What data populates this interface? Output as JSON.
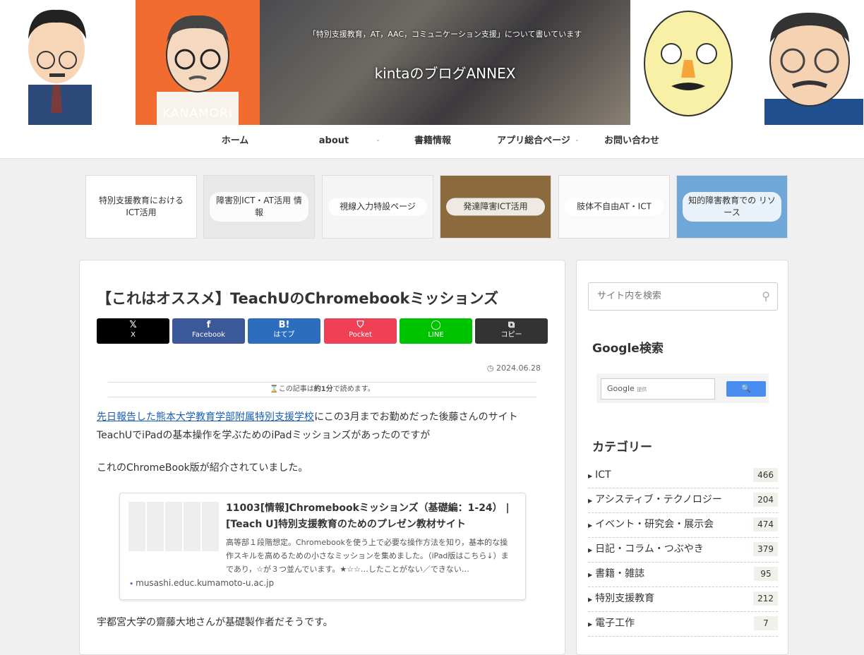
{
  "header": {
    "caption": "「特別支援教育，AT，AAC，コミュニケーション支援」について書いています",
    "site_title": "kintaのブログANNEX",
    "portrait_label": "KANAMORI"
  },
  "nav": {
    "items": [
      {
        "label": "ホーム"
      },
      {
        "label": "about"
      },
      {
        "label": "書籍情報"
      },
      {
        "label": "アプリ総合ページ"
      },
      {
        "label": "お問い合わせ"
      }
    ],
    "chevron": "⌄"
  },
  "carousel": [
    {
      "label": "特別支援教育における ICT活用"
    },
    {
      "label": "障害別ICT・AT活用 情報"
    },
    {
      "label": "視線入力特設ページ"
    },
    {
      "label": "発達障害ICT活用"
    },
    {
      "label": "肢体不自由AT・ICT"
    },
    {
      "label": "知的障害教育での リソース"
    }
  ],
  "article": {
    "title": "【これはオススメ】TeachUのChromebookミッションズ",
    "share": [
      {
        "icon": "𝕏",
        "label": "X",
        "color": "#000000"
      },
      {
        "icon": "f",
        "label": "Facebook",
        "color": "#3b5998"
      },
      {
        "icon": "B!",
        "label": "はてブ",
        "color": "#2c6ebd"
      },
      {
        "icon": "⛉",
        "label": "Pocket",
        "color": "#ef4056"
      },
      {
        "icon": "◯",
        "label": "LINE",
        "color": "#00c300"
      },
      {
        "icon": "⧉",
        "label": "コピー",
        "color": "#333333"
      }
    ],
    "date": "2024.06.28",
    "readtime_prefix": "この記事は",
    "readtime_value": "約1分",
    "readtime_suffix": "で読めます。",
    "para1_link": "先日報告した熊本大学教育学部附属特別支援学校",
    "para1_rest": "にこの3月までお勤めだった後藤さんのサイト",
    "para1_line2": "TeachUでiPadの基本操作を学ぶためのiPadミッションズがあったのですが",
    "para2": "これのChromeBook版が紹介されていました。",
    "card": {
      "title": "11003[情報]Chromebookミッションズ（基礎編：1-24） | [Teach U]特別支援教育のためのプレゼン教材サイト",
      "desc": "高等部１段階想定。Chromebookを使う上で必要な操作方法を知り，基本的な操作スキルを高めるための小さなミッションを集めました。（iPad版はこちら↓）まであり，☆が３つ並んでいます。★☆☆…したことがない／できない…",
      "domain": "musashi.educ.kumamoto-u.ac.jp"
    },
    "para3": "宇都宮大学の齋藤大地さんが基礎製作者だそうです。"
  },
  "sidebar": {
    "search_placeholder": "サイト内を検索",
    "google_title": "Google検索",
    "google_input": "Google",
    "google_input_small": "提供",
    "google_button": "🔍",
    "category_title": "カテゴリー",
    "categories": [
      {
        "name": "ICT",
        "count": "466"
      },
      {
        "name": "アシスティブ・テクノロジー",
        "count": "204"
      },
      {
        "name": "イベント・研究会・展示会",
        "count": "474"
      },
      {
        "name": "日記・コラム・つぶやき",
        "count": "379"
      },
      {
        "name": "書籍・雑誌",
        "count": "95"
      },
      {
        "name": "特別支援教育",
        "count": "212"
      },
      {
        "name": "電子工作",
        "count": "7"
      }
    ]
  }
}
